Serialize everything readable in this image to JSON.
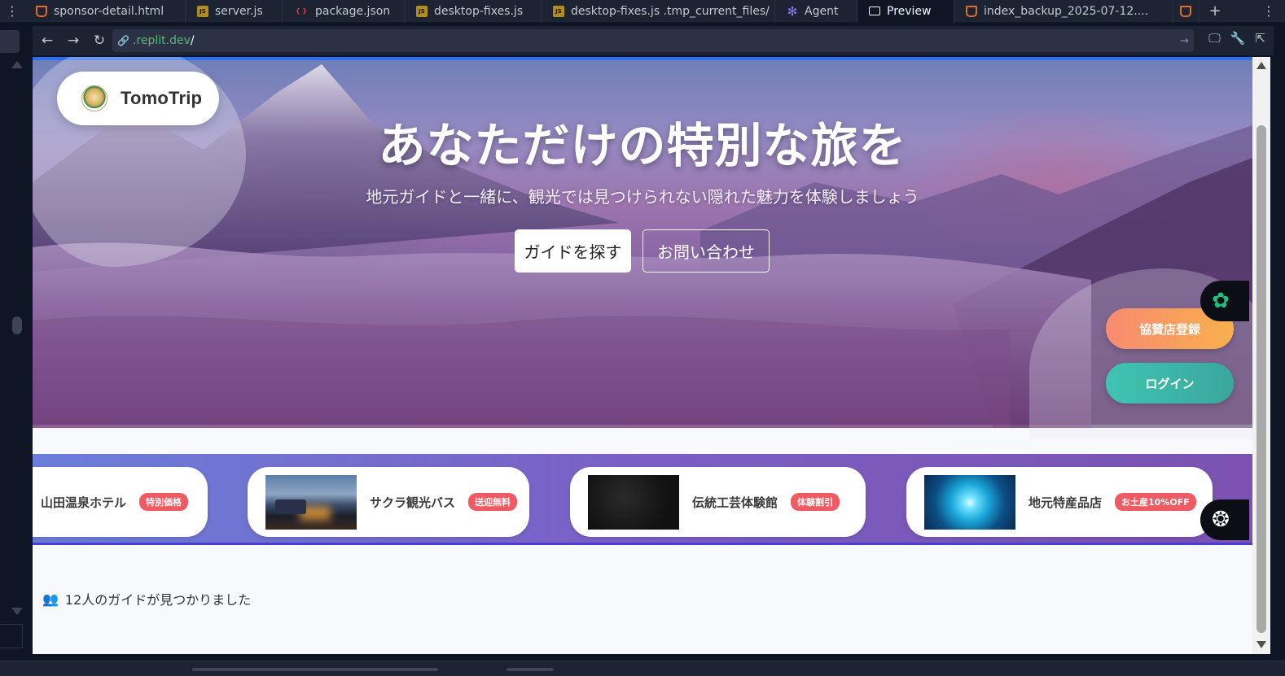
{
  "ide": {
    "tabs": [
      {
        "label": "sponsor-detail.html",
        "icon": "html-file-icon"
      },
      {
        "label": "server.js",
        "icon": "js-file-icon"
      },
      {
        "label": "package.json",
        "icon": "json-file-icon"
      },
      {
        "label": "desktop-fixes.js",
        "icon": "js-file-icon"
      },
      {
        "label": "desktop-fixes.js .tmp_current_files/",
        "icon": "js-file-icon"
      },
      {
        "label": "Agent",
        "icon": "agent-icon"
      },
      {
        "label": "Preview",
        "icon": "preview-icon"
      },
      {
        "label": "index_backup_2025-07-12....",
        "icon": "html-file-icon"
      }
    ],
    "json_icon_text": "{ }",
    "js_icon_text": "JS",
    "add_tab": "+",
    "menu_glyph": "⋮"
  },
  "urlbar": {
    "host": ".replit.dev",
    "path": "/"
  },
  "site": {
    "logo_text": "TomoTrip",
    "hero_title": "あなただけの特別な旅を",
    "hero_subtitle": "地元ガイドと一緒に、観光では見つけられない隠れた魅力を体験しましょう",
    "find_guide_label": "ガイドを探す",
    "contact_label": "お問い合わせ",
    "sponsor_register_label": "協賛店登録",
    "login_label": "ログイン",
    "sponsors": [
      {
        "name": "山田温泉ホテル",
        "badge": "特別価格"
      },
      {
        "name": "サクラ観光バス",
        "badge": "送迎無料"
      },
      {
        "name": "伝統工芸体験館",
        "badge": "体験割引"
      },
      {
        "name": "地元特産品店",
        "badge": "お土産10%OFF"
      }
    ],
    "guide_count_text": "12人のガイドが見つかりました"
  },
  "colors": {
    "accent_blue": "#2f6fea",
    "sponsor_btn_start": "#f98a72",
    "login_btn": "#3fc4b0",
    "badge_red": "#f05a62"
  }
}
